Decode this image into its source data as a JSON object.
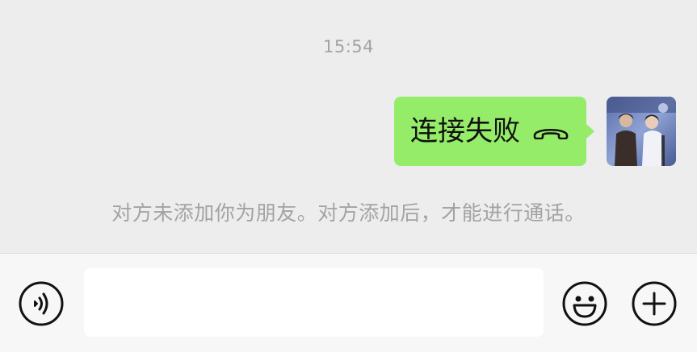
{
  "chat": {
    "timestamp": "15:54",
    "message": {
      "text": "连接失败",
      "icon": "hangup-icon",
      "bubble_color": "#95ec69"
    },
    "system_notice": "对方未添加你为朋友。对方添加后，才能进行通话。"
  },
  "input_bar": {
    "voice_icon": "voice-icon",
    "emoji_icon": "emoji-icon",
    "plus_icon": "plus-icon",
    "input_value": ""
  },
  "colors": {
    "background": "#ededed",
    "input_bar_bg": "#f7f7f7",
    "muted_text": "#a3a3a3"
  }
}
